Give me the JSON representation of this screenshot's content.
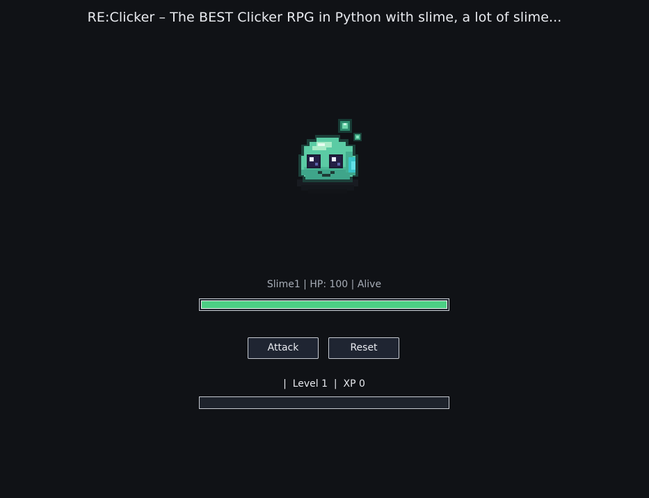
{
  "window": {
    "title": "RE:Clicker – The BEST Clicker RPG in Python with slime, a lot of slime..."
  },
  "enemy": {
    "name": "Slime1",
    "hp": 100,
    "state": "Alive",
    "status_text": "Slime1 | HP: 100 | Alive",
    "hp_fraction": 1.0,
    "sprite_icon": "slime-sprite-icon"
  },
  "controls": {
    "attack_label": "Attack",
    "reset_label": "Reset"
  },
  "player": {
    "level": 1,
    "xp": 0,
    "level_text": "|  Level 1  |  XP 0",
    "xp_fraction": 0
  },
  "colors": {
    "background": "#101216",
    "hp_fill": "#4ccf84",
    "button_bg": "#1f2532",
    "bar_border": "#c7cbd2",
    "text": "#e8eaef",
    "muted_text": "#a6acb6"
  }
}
